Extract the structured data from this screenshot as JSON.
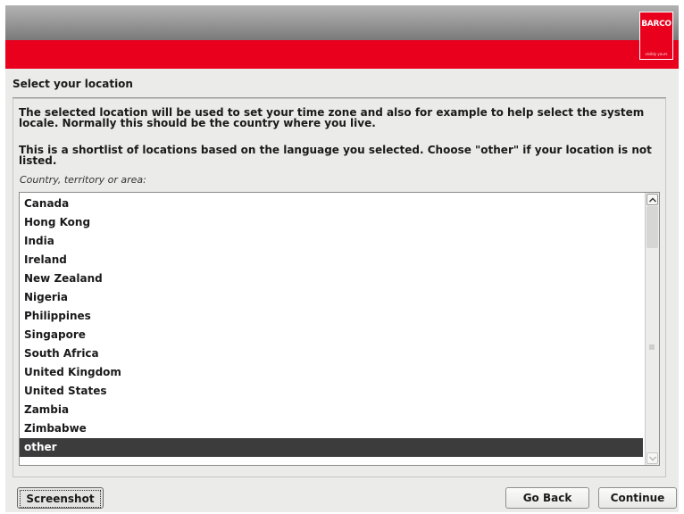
{
  "brand": {
    "logo_text": "BARCO",
    "logo_tagline": "visibly yours"
  },
  "page": {
    "title": "Select your location",
    "intro_1": "The selected location will be used to set your time zone and also for example to help select the system locale. Normally this should be the country where you live.",
    "intro_2": "This is a shortlist of locations based on the language you selected. Choose \"other\" if your location is not listed.",
    "field_label": "Country, territory or area:"
  },
  "locations": {
    "items": [
      "Canada",
      "Hong Kong",
      "India",
      "Ireland",
      "New Zealand",
      "Nigeria",
      "Philippines",
      "Singapore",
      "South Africa",
      "United Kingdom",
      "United States",
      "Zambia",
      "Zimbabwe",
      "other"
    ],
    "selected": "other"
  },
  "buttons": {
    "screenshot": "Screenshot",
    "go_back": "Go Back",
    "continue": "Continue"
  },
  "colors": {
    "brand_red": "#e8001c",
    "selection": "#3c3c3c"
  }
}
